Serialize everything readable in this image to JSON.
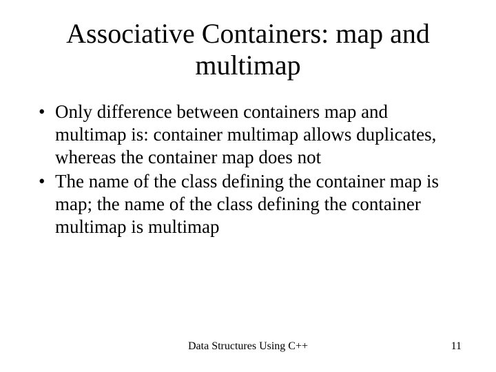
{
  "slide": {
    "title": "Associative Containers: map and multimap",
    "bullets": [
      "Only difference between containers map and multimap is: container multimap allows duplicates, whereas the container map does not",
      "The name of the class defining the container map is map; the name of the class defining the container multimap is multimap"
    ],
    "footer": {
      "center": "Data Structures Using C++",
      "page": "11"
    }
  }
}
